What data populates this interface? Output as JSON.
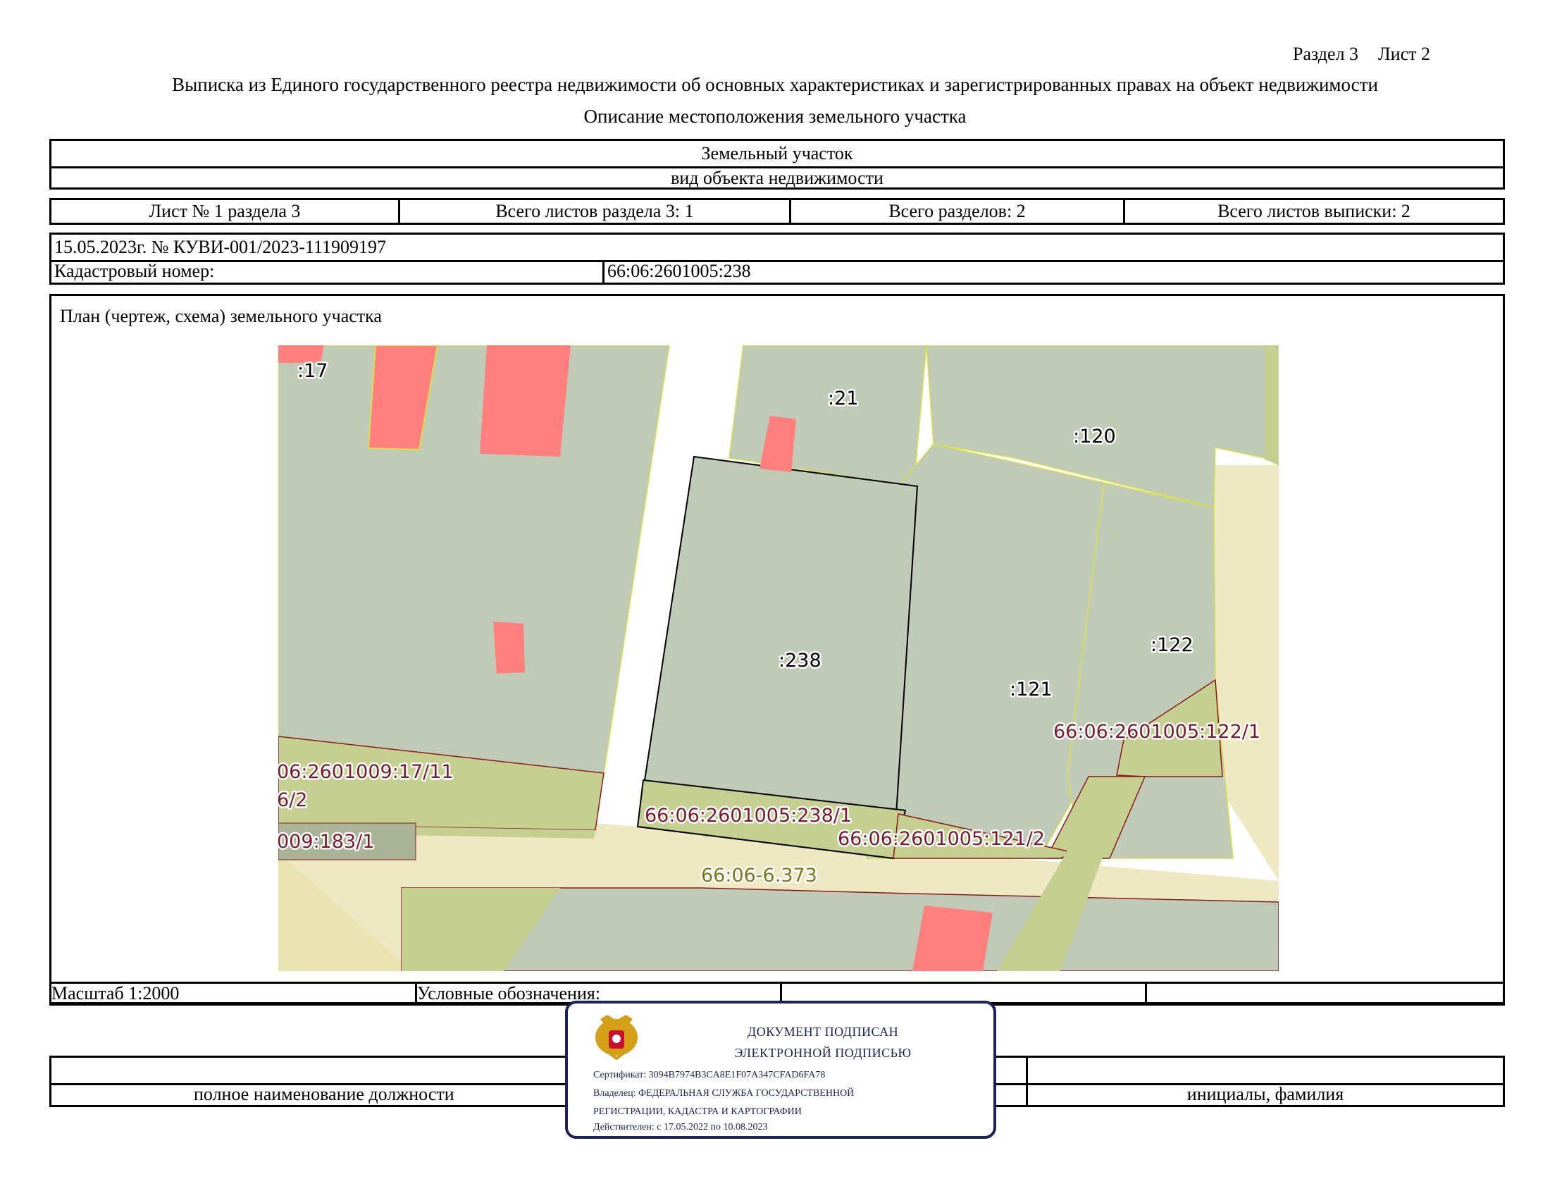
{
  "header": {
    "section": "Раздел 3",
    "sheet": "Лист 2",
    "title": "Выписка из Единого государственного реестра недвижимости об основных характеристиках и зарегистрированных правах на объект недвижимости",
    "subtitle": "Описание местоположения земельного участка"
  },
  "object": {
    "name": "Земельный участок",
    "kind_label": "вид объекта недвижимости"
  },
  "sheet_info": {
    "sheet_no": "Лист № 1 раздела 3",
    "total_section_sheets": "Всего листов раздела 3: 1",
    "total_sections": "Всего разделов: 2",
    "total_extract_sheets": "Всего листов выписки: 2"
  },
  "record": {
    "date_number": "15.05.2023г. № КУВИ-001/2023-111909197",
    "cadastral_label": "Кадастровый номер:",
    "cadastral_value": "66:06:2601005:238"
  },
  "plan": {
    "title": "План (чертеж, схема) земельного участка",
    "labels": {
      "p17": ":17",
      "p21": ":21",
      "p120": ":120",
      "p238": ":238",
      "p121": ":121",
      "p122": ":122",
      "z122_1": "66:06:2601005:122/1",
      "z17_11": "06:2601009:17/11",
      "z6_2": "6/2",
      "z238_1": "66:06:2601005:238/1",
      "z121_2": "66:06:2601005:121/2",
      "z183_1": "009:183/1",
      "zone": "66:06-6.373"
    }
  },
  "footer": {
    "scale": "Масштаб 1:2000",
    "legend": "Условные обозначения:",
    "position_label": "полное наименование должности",
    "name_label": "инициалы, фамилия"
  },
  "stamp": {
    "line1": "ДОКУМЕНТ ПОДПИСАН",
    "line2": "ЭЛЕКТРОННОЙ ПОДПИСЬЮ",
    "certificate": "Сертификат: 3094B7974B3CA8E1F07A347CFAD6FA78",
    "owner": "Владелец: ФЕДЕРАЛЬНАЯ СЛУЖБА ГОСУДАРСТВЕННОЙ",
    "owner2": "РЕГИСТРАЦИИ, КАДАСТРА И КАРТОГРАФИИ",
    "valid": "Действителен: с 17.05.2022 по 10.08.2023"
  },
  "colors": {
    "parcel": "#bfcab7",
    "building": "#ff7f7f",
    "zone_yellow": "#efe9c3",
    "zone_green": "#c5cf8f",
    "border_red": "#8b1a1a",
    "border_yellow": "#d9e04a",
    "stamp_blue": "#1c2158"
  }
}
